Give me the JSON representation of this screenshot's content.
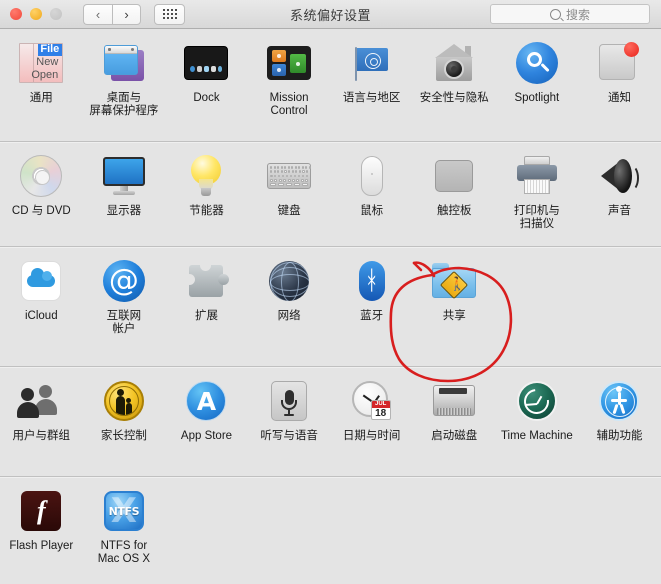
{
  "window": {
    "title": "系统偏好设置",
    "traffic_lights": [
      "close",
      "minimize",
      "zoom"
    ],
    "back_label": "‹",
    "forward_label": "›",
    "grid_label": "show-all"
  },
  "search": {
    "placeholder": "搜索",
    "value": ""
  },
  "colors": {
    "window_bg": "#e4e4e4",
    "titlebar_top": "#e9e9e9",
    "titlebar_bottom": "#d8d8d8",
    "divider": "#c0c0c0",
    "label_text": "#1b1b1b",
    "annotation_red": "#d81e1e",
    "close_red": "#f2483a",
    "minimize_yellow": "#f0a91c",
    "zoom_gray": "#c2c2c2",
    "accent_blue": "#2f84de"
  },
  "annotation": {
    "color": "#d81e1e",
    "target": "共享",
    "shape": "hand-drawn-circle-with-arrow"
  },
  "rows": [
    {
      "panes": [
        {
          "label": "通用",
          "icon": "general-icon",
          "menu_items": [
            "File",
            "New",
            "Open"
          ]
        },
        {
          "label": "桌面与\n屏幕保护程序",
          "icon": "desktop-screensaver-icon"
        },
        {
          "label": "Dock",
          "icon": "dock-icon"
        },
        {
          "label": "Mission\nControl",
          "icon": "mission-control-icon"
        },
        {
          "label": "语言与地区",
          "icon": "language-region-flag-icon"
        },
        {
          "label": "安全性与隐私",
          "icon": "security-privacy-icon"
        },
        {
          "label": "Spotlight",
          "icon": "spotlight-icon"
        },
        {
          "label": "通知",
          "icon": "notifications-icon"
        }
      ]
    },
    {
      "panes": [
        {
          "label": "CD 与 DVD",
          "icon": "cd-dvd-icon"
        },
        {
          "label": "显示器",
          "icon": "displays-icon"
        },
        {
          "label": "节能器",
          "icon": "energy-saver-icon"
        },
        {
          "label": "键盘",
          "icon": "keyboard-icon"
        },
        {
          "label": "鼠标",
          "icon": "mouse-icon"
        },
        {
          "label": "触控板",
          "icon": "trackpad-icon"
        },
        {
          "label": "打印机与\n扫描仪",
          "icon": "printers-scanners-icon"
        },
        {
          "label": "声音",
          "icon": "sound-icon"
        }
      ]
    },
    {
      "panes": [
        {
          "label": "iCloud",
          "icon": "icloud-icon"
        },
        {
          "label": "互联网\n帐户",
          "icon": "internet-accounts-icon"
        },
        {
          "label": "扩展",
          "icon": "extensions-icon"
        },
        {
          "label": "网络",
          "icon": "network-icon"
        },
        {
          "label": "蓝牙",
          "icon": "bluetooth-icon"
        },
        {
          "label": "共享",
          "icon": "sharing-icon",
          "highlighted": true
        },
        {
          "label": "",
          "icon": ""
        },
        {
          "label": "",
          "icon": ""
        }
      ]
    },
    {
      "panes": [
        {
          "label": "用户与群组",
          "icon": "users-groups-icon"
        },
        {
          "label": "家长控制",
          "icon": "parental-controls-icon"
        },
        {
          "label": "App Store",
          "icon": "app-store-icon"
        },
        {
          "label": "听写与语音",
          "icon": "dictation-speech-icon"
        },
        {
          "label": "日期与时间",
          "icon": "date-time-icon",
          "calendar_month": "JUL",
          "calendar_day": "18"
        },
        {
          "label": "启动磁盘",
          "icon": "startup-disk-icon"
        },
        {
          "label": "Time Machine",
          "icon": "time-machine-icon"
        },
        {
          "label": "辅助功能",
          "icon": "accessibility-icon"
        }
      ]
    },
    {
      "panes": [
        {
          "label": "Flash Player",
          "icon": "flash-player-icon",
          "glyph": "f"
        },
        {
          "label": "NTFS for\nMac OS X",
          "icon": "ntfs-for-mac-icon",
          "glyph": "NTFS"
        },
        {
          "label": "",
          "icon": ""
        },
        {
          "label": "",
          "icon": ""
        },
        {
          "label": "",
          "icon": ""
        },
        {
          "label": "",
          "icon": ""
        },
        {
          "label": "",
          "icon": ""
        },
        {
          "label": "",
          "icon": ""
        }
      ]
    }
  ]
}
